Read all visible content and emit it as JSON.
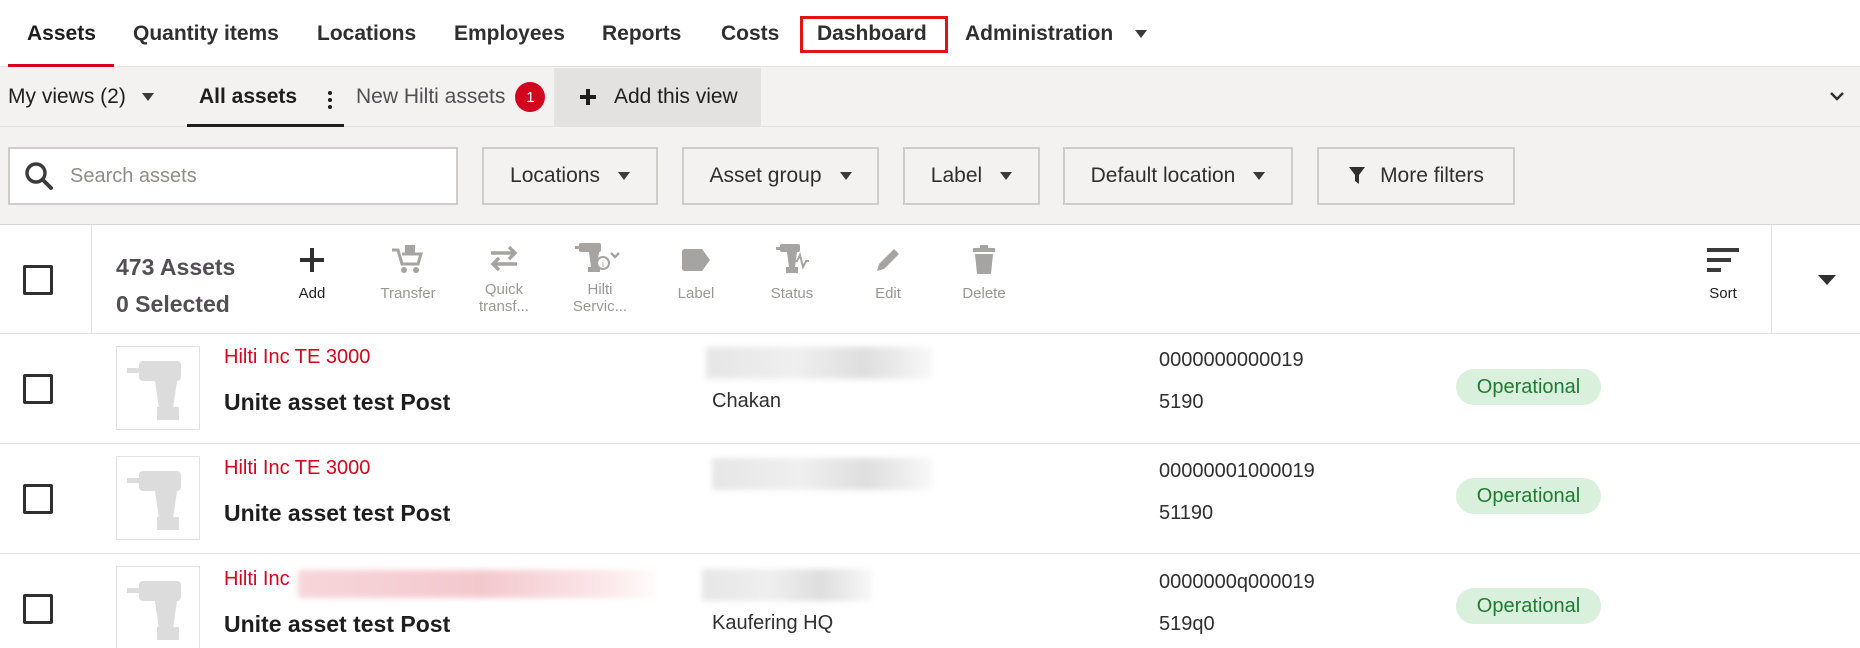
{
  "nav": {
    "tabs": [
      "Assets",
      "Quantity items",
      "Locations",
      "Employees",
      "Reports",
      "Costs",
      "Dashboard",
      "Administration"
    ]
  },
  "views": {
    "my_views_label": "My views (2)",
    "all_assets_label": "All assets",
    "new_view_label": "New Hilti assets",
    "new_view_badge": "1",
    "add_view_label": "Add this view"
  },
  "filters": {
    "search_placeholder": "Search assets",
    "locations": "Locations",
    "asset_group": "Asset group",
    "label": "Label",
    "default_location": "Default location",
    "more_filters": "More filters"
  },
  "toolbar": {
    "asset_count": "473 Assets",
    "selected_count": "0 Selected",
    "actions": {
      "add": "Add",
      "transfer": "Transfer",
      "quick_transfer_1": "Quick",
      "quick_transfer_2": "transf...",
      "hilti_service_1": "Hilti",
      "hilti_service_2": "Servic...",
      "label": "Label",
      "status": "Status",
      "edit": "Edit",
      "delete": "Delete",
      "sort": "Sort"
    }
  },
  "rows": [
    {
      "brand": "Hilti Inc TE 3000",
      "name": "Unite asset test Post",
      "location": "Chakan",
      "serial": "0000000000019",
      "inventory": "5190",
      "status": "Operational"
    },
    {
      "brand": "Hilti Inc TE 3000",
      "name": "Unite asset test Post",
      "location": "",
      "serial": "00000001000019",
      "inventory": "51190",
      "status": "Operational"
    },
    {
      "brand": "Hilti Inc",
      "name": "Unite asset test Post",
      "location": "Kaufering HQ",
      "serial": "0000000q000019",
      "inventory": "519q0",
      "status": "Operational"
    }
  ],
  "colors": {
    "brand_red": "#d2051e",
    "status_green_bg": "#d8f0dc",
    "status_green_text": "#1f7a32",
    "highlight_box": "#e2111a"
  },
  "icons": [
    "search-icon",
    "caret-down-icon",
    "plus-icon",
    "filter-icon",
    "chevron-down-icon",
    "kebab-icon",
    "cart-icon",
    "transfer-icon",
    "drill-service-icon",
    "label-tag-icon",
    "status-icon",
    "pencil-icon",
    "trash-icon",
    "sort-icon",
    "drill-thumbnail-icon"
  ]
}
